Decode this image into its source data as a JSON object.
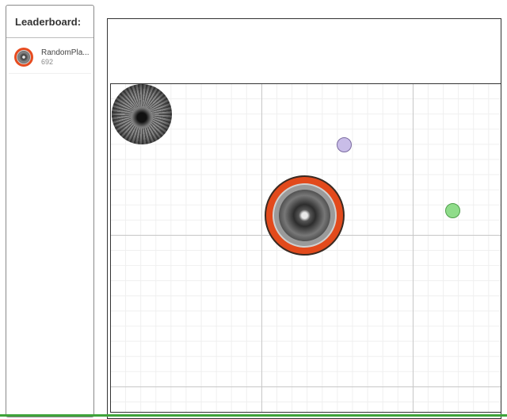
{
  "leaderboard": {
    "title": "Leaderboard:",
    "entries": [
      {
        "name": "RandomPla...",
        "score": "692"
      }
    ]
  },
  "game": {
    "objects": [
      {
        "kind": "black-hole",
        "icon": "vortex-icon"
      },
      {
        "kind": "player",
        "icon": "speaker-icon",
        "ring_color": "#e24a1c"
      },
      {
        "kind": "food",
        "icon": "circle-icon",
        "color": "#c9bde8"
      },
      {
        "kind": "food",
        "icon": "circle-icon",
        "color": "#8fdc8a"
      }
    ]
  }
}
